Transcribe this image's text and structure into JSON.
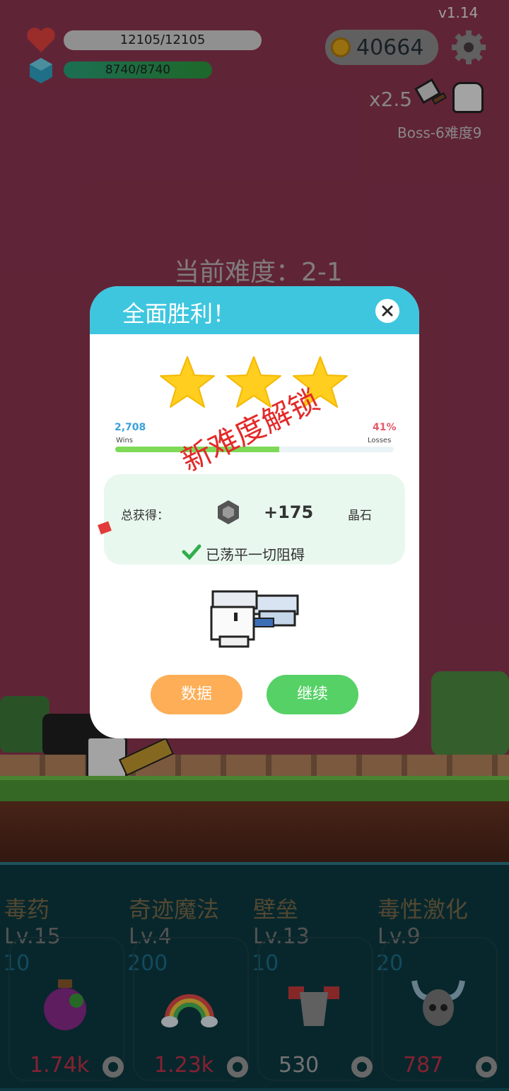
{
  "version": "v1.14",
  "player": {
    "hp_text": "12105/12105",
    "hp_fraction": 1.0,
    "mp_text": "8740/8740",
    "mp_fraction": 1.0
  },
  "coins": "40664",
  "multiplier": "x2.5",
  "boss_label": "Boss-6难度9",
  "current_difficulty": "当前难度：2-1",
  "modal": {
    "title": "全面胜利！",
    "stars": 3,
    "wins_value": "2,708",
    "wins_label": "Wins",
    "losses_value": "41%",
    "losses_label": "Losses",
    "wins_fraction": 0.59,
    "stamp": "新难度解锁",
    "reward_label": "总获得：",
    "reward_amount": "+175",
    "reward_unit": "晶石",
    "cleared_text": "已荡平一切阻碍",
    "data_button": "数据",
    "continue_button": "继续"
  },
  "colors": {
    "modal_header": "#3ec6df",
    "data_button": "#fdae56",
    "continue_button": "#56d166",
    "wins_bar": "#7ed957",
    "star": "#ffce1f"
  },
  "skills": [
    {
      "name": "毒药",
      "level": "Lv.15",
      "cost": "10",
      "value": "1.74",
      "unit": "k",
      "icon": "poison-potion-icon"
    },
    {
      "name": "奇迹魔法",
      "level": "Lv.4",
      "cost": "200",
      "value": "1.23",
      "unit": "k",
      "icon": "rainbow-icon"
    },
    {
      "name": "壁垒",
      "level": "Lv.13",
      "cost": "10",
      "value": "530",
      "unit": "",
      "icon": "armor-icon"
    },
    {
      "name": "毒性激化",
      "level": "Lv.9",
      "cost": "20",
      "value": "787",
      "unit": "",
      "icon": "viking-skull-icon"
    }
  ]
}
